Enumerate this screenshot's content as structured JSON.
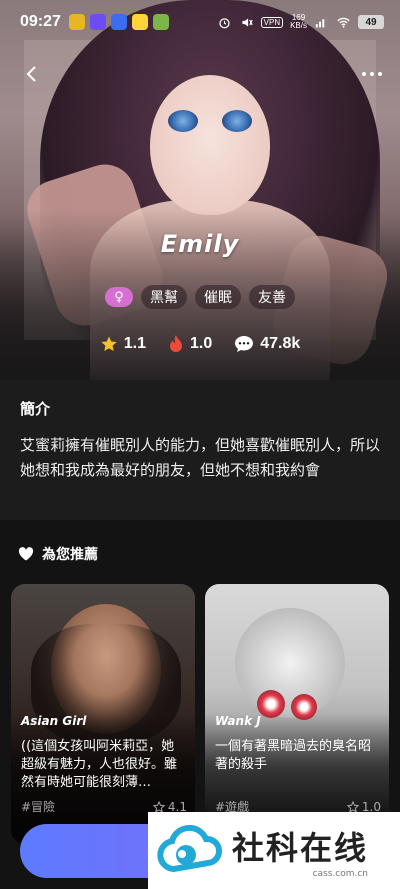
{
  "status_bar": {
    "time": "09:27",
    "net_speed_value": "169",
    "net_speed_unit": "KB/s",
    "vpn_label": "VPN",
    "battery": "49"
  },
  "nav": {
    "back_icon": "chevron-left-icon",
    "more_icon": "more-dots-icon"
  },
  "character": {
    "name": "Emily",
    "gender_symbol": "♀",
    "tags": [
      "黑幫",
      "催眠",
      "友善"
    ],
    "rating": "1.1",
    "heat": "1.0",
    "chats": "47.8k"
  },
  "intro": {
    "title": "簡介",
    "text": "艾蜜莉擁有催眠別人的能力，但她喜歡催眠別人，所以她想和我成為最好的朋友，但她不想和我約會"
  },
  "recommend": {
    "title": "為您推薦",
    "cards": [
      {
        "name": "Asian Girl",
        "desc": "((這個女孩叫阿米莉亞，她超級有魅力，人也很好。雖然有時她可能很刻薄…",
        "tag": "#冒險",
        "rating": "4.1"
      },
      {
        "name": "Wank J",
        "desc": "一個有著黑暗過去的臭名昭著的殺手",
        "tag": "#遊戲",
        "rating": "1.0"
      }
    ]
  },
  "watermark": {
    "title": "社科在线",
    "url": "cass.com.cn"
  },
  "colors": {
    "accent_blue": "#5d7bff",
    "gender_pink": "#d66fd2",
    "star_yellow": "#f6c12c",
    "fire_red": "#ee4a3a"
  }
}
